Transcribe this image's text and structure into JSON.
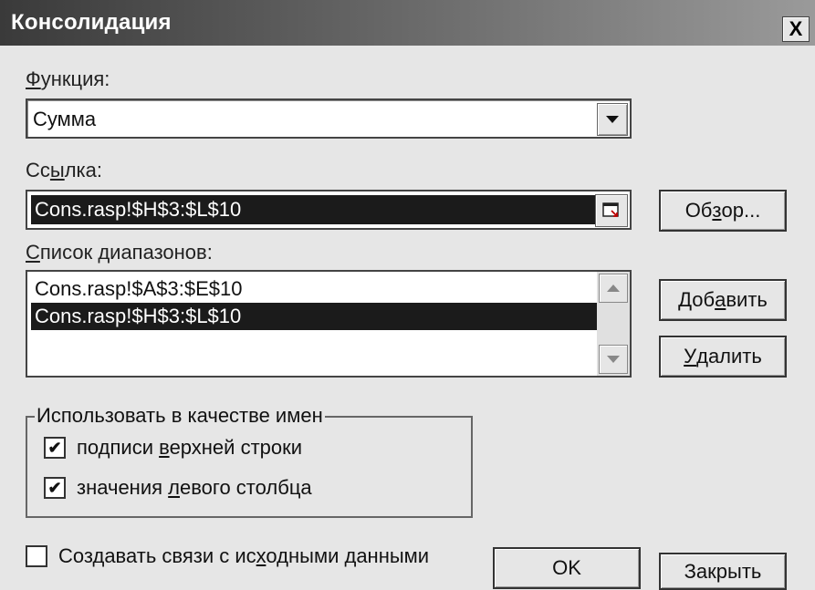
{
  "window": {
    "title": "Консолидация",
    "close_glyph": "X"
  },
  "function": {
    "label": "Функция:",
    "label_mnemonic": "Ф",
    "label_rest": "ункция:",
    "value": "Сумма"
  },
  "reference": {
    "label_pre": "Сс",
    "label_mnemonic": "ы",
    "label_post": "лка:",
    "value": "Cons.rasp!$H$3:$L$10"
  },
  "browse_button": {
    "pre": "Об",
    "mnemonic": "з",
    "post": "ор..."
  },
  "ranges": {
    "label_mnemonic": "С",
    "label_rest": "писок диапазонов:",
    "items": [
      {
        "text": "Cons.rasp!$A$3:$E$10",
        "selected": false
      },
      {
        "text": "Cons.rasp!$H$3:$L$10",
        "selected": true
      }
    ]
  },
  "add_button": {
    "pre": "Доб",
    "mnemonic": "а",
    "post": "вить"
  },
  "delete_button": {
    "mnemonic": "У",
    "post": "далить"
  },
  "use_labels": {
    "legend": "Использовать в качестве имен",
    "top_row": {
      "pre": "подписи ",
      "mnemonic": "в",
      "post": "ерхней строки",
      "checked": true
    },
    "left_column": {
      "pre": "значения ",
      "mnemonic": "л",
      "post": "евого столбца",
      "checked": true
    }
  },
  "create_links": {
    "pre": "Создавать связи с ис",
    "mnemonic": "х",
    "post": "одными данными",
    "checked": false
  },
  "ok_button": "OK",
  "close_button": "Закрыть",
  "check_glyph": "✔"
}
